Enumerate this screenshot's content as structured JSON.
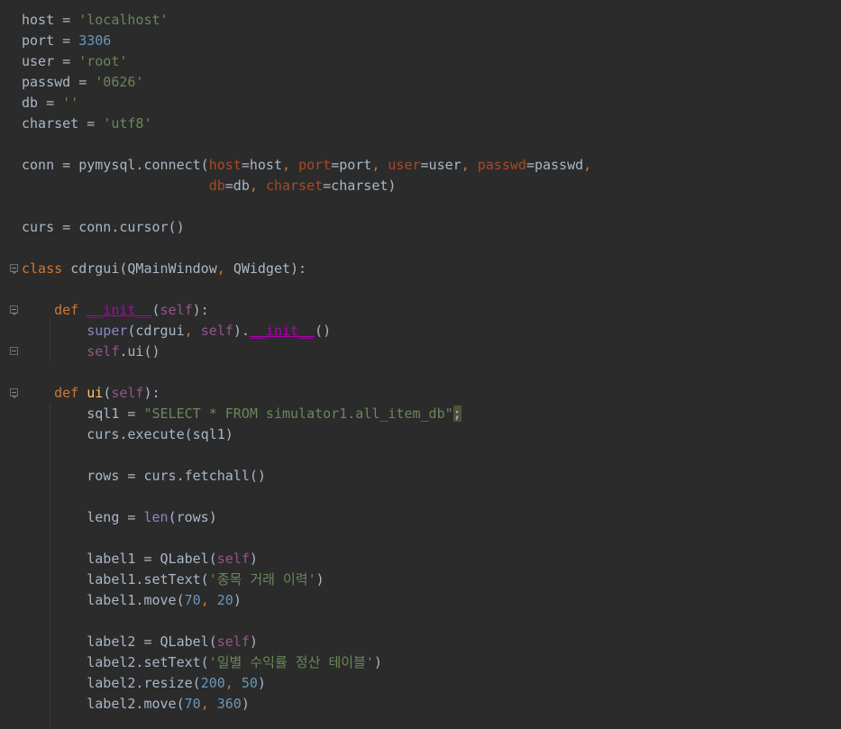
{
  "editor": {
    "lines": [
      {
        "tokens": [
          [
            "host = ",
            "default"
          ],
          [
            "'localhost'",
            "str"
          ]
        ]
      },
      {
        "tokens": [
          [
            "port = ",
            "default"
          ],
          [
            "3306",
            "num"
          ]
        ]
      },
      {
        "tokens": [
          [
            "user = ",
            "default"
          ],
          [
            "'root'",
            "str"
          ]
        ]
      },
      {
        "tokens": [
          [
            "passwd = ",
            "default"
          ],
          [
            "'0626'",
            "str"
          ]
        ]
      },
      {
        "tokens": [
          [
            "db = ",
            "default"
          ],
          [
            "''",
            "str"
          ]
        ]
      },
      {
        "tokens": [
          [
            "charset = ",
            "default"
          ],
          [
            "'utf8'",
            "str"
          ]
        ]
      },
      {
        "tokens": []
      },
      {
        "tokens": [
          [
            "conn = pymysql.connect(",
            "default"
          ],
          [
            "host",
            "param"
          ],
          [
            "=host",
            "default"
          ],
          [
            ", ",
            "kw"
          ],
          [
            "port",
            "param"
          ],
          [
            "=port",
            "default"
          ],
          [
            ", ",
            "kw"
          ],
          [
            "user",
            "param"
          ],
          [
            "=user",
            "default"
          ],
          [
            ", ",
            "kw"
          ],
          [
            "passwd",
            "param"
          ],
          [
            "=passwd",
            "default"
          ],
          [
            ",",
            "kw"
          ]
        ]
      },
      {
        "tokens": [
          [
            "                       ",
            "default"
          ],
          [
            "db",
            "param"
          ],
          [
            "=db",
            "default"
          ],
          [
            ", ",
            "kw"
          ],
          [
            "charset",
            "param"
          ],
          [
            "=charset)",
            "default"
          ]
        ]
      },
      {
        "tokens": []
      },
      {
        "tokens": [
          [
            "curs = conn.cursor()",
            "default"
          ]
        ]
      },
      {
        "tokens": []
      },
      {
        "tokens": [
          [
            "class ",
            "kw"
          ],
          [
            "cdrgui(QMainWindow",
            "default"
          ],
          [
            ", ",
            "kw"
          ],
          [
            "QWidget):",
            "default"
          ]
        ]
      },
      {
        "tokens": []
      },
      {
        "tokens": [
          [
            "    ",
            "default"
          ],
          [
            "def ",
            "kw"
          ],
          [
            "__init__",
            "magic"
          ],
          [
            "(",
            "default"
          ],
          [
            "self",
            "self"
          ],
          [
            "):",
            "default"
          ]
        ]
      },
      {
        "tokens": [
          [
            "        ",
            "default"
          ],
          [
            "super",
            "builtin"
          ],
          [
            "(cdrgui",
            "default"
          ],
          [
            ", ",
            "kw"
          ],
          [
            "self",
            "self"
          ],
          [
            ").",
            "default"
          ],
          [
            "__init__",
            "magic"
          ],
          [
            "()",
            "default"
          ]
        ]
      },
      {
        "tokens": [
          [
            "        ",
            "default"
          ],
          [
            "self",
            "self"
          ],
          [
            ".ui()",
            "default"
          ]
        ]
      },
      {
        "tokens": []
      },
      {
        "tokens": [
          [
            "    ",
            "default"
          ],
          [
            "def ",
            "kw"
          ],
          [
            "ui",
            "func"
          ],
          [
            "(",
            "default"
          ],
          [
            "self",
            "self"
          ],
          [
            "):",
            "default"
          ]
        ]
      },
      {
        "tokens": [
          [
            "        sql1 = ",
            "default"
          ],
          [
            "\"SELECT * FROM simulator1.all_item_db\"",
            "str"
          ],
          [
            ";",
            "warn"
          ]
        ]
      },
      {
        "tokens": [
          [
            "        curs.execute(sql1)",
            "default"
          ]
        ]
      },
      {
        "tokens": []
      },
      {
        "tokens": [
          [
            "        rows = curs.fetchall()",
            "default"
          ]
        ]
      },
      {
        "tokens": []
      },
      {
        "tokens": [
          [
            "        leng = ",
            "default"
          ],
          [
            "len",
            "builtin"
          ],
          [
            "(rows)",
            "default"
          ]
        ]
      },
      {
        "tokens": []
      },
      {
        "tokens": [
          [
            "        label1 = QLabel(",
            "default"
          ],
          [
            "self",
            "self"
          ],
          [
            ")",
            "default"
          ]
        ]
      },
      {
        "tokens": [
          [
            "        label1.setText(",
            "default"
          ],
          [
            "'종목 거래 이력'",
            "str"
          ],
          [
            ")",
            "default"
          ]
        ]
      },
      {
        "tokens": [
          [
            "        label1.move(",
            "default"
          ],
          [
            "70",
            "num"
          ],
          [
            ", ",
            "kw"
          ],
          [
            "20",
            "num"
          ],
          [
            ")",
            "default"
          ]
        ]
      },
      {
        "tokens": []
      },
      {
        "tokens": [
          [
            "        label2 = QLabel(",
            "default"
          ],
          [
            "self",
            "self"
          ],
          [
            ")",
            "default"
          ]
        ]
      },
      {
        "tokens": [
          [
            "        label2.setText(",
            "default"
          ],
          [
            "'일별 수익률 정산 테이블'",
            "str"
          ],
          [
            ")",
            "default"
          ]
        ]
      },
      {
        "tokens": [
          [
            "        label2.resize(",
            "default"
          ],
          [
            "200",
            "num"
          ],
          [
            ", ",
            "kw"
          ],
          [
            "50",
            "num"
          ],
          [
            ")",
            "default"
          ]
        ]
      },
      {
        "tokens": [
          [
            "        label2.move(",
            "default"
          ],
          [
            "70",
            "num"
          ],
          [
            ", ",
            "kw"
          ],
          [
            "360",
            "num"
          ],
          [
            ")",
            "default"
          ]
        ]
      }
    ]
  },
  "colors": {
    "background": "#2b2b2b",
    "default": "#a9b7c6",
    "string": "#6a8759",
    "number": "#6897bb",
    "keyword": "#cc7832",
    "param": "#aa4926",
    "self": "#94558d",
    "magic": "#b200b2",
    "builtin": "#8888c6",
    "function": "#ffc66d"
  },
  "fold_markers": [
    "fold-icon-class",
    "fold-icon-init",
    "fold-icon-init-end",
    "fold-icon-ui"
  ]
}
